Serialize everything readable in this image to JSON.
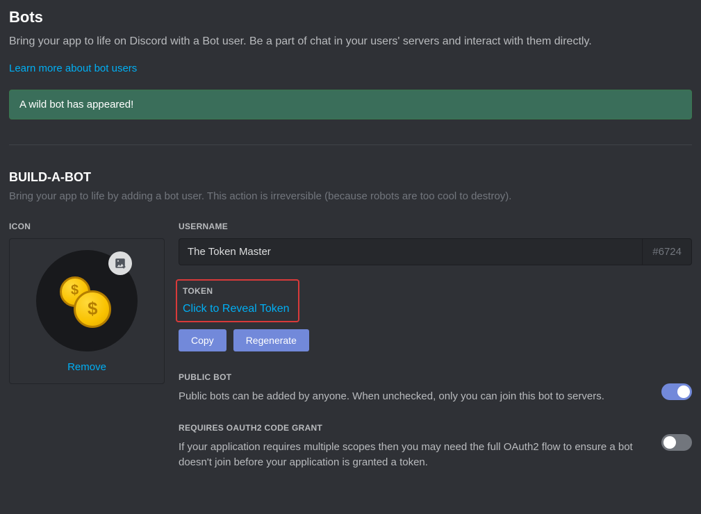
{
  "header": {
    "title": "Bots",
    "description": "Bring your app to life on Discord with a Bot user. Be a part of chat in your users' servers and interact with them directly.",
    "learn_more": "Learn more about bot users"
  },
  "alert": {
    "message": "A wild bot has appeared!"
  },
  "build": {
    "title": "BUILD-A-BOT",
    "description": "Bring your app to life by adding a bot user. This action is irreversible (because robots are too cool to destroy).",
    "icon_label": "ICON",
    "remove_label": "Remove",
    "username_label": "USERNAME",
    "username_value": "The Token Master",
    "discriminator": "#6724",
    "token_label": "TOKEN",
    "reveal_label": "Click to Reveal Token",
    "copy_label": "Copy",
    "regenerate_label": "Regenerate"
  },
  "settings": {
    "public_bot": {
      "label": "PUBLIC BOT",
      "description": "Public bots can be added by anyone. When unchecked, only you can join this bot to servers.",
      "enabled": true
    },
    "oauth2": {
      "label": "REQUIRES OAUTH2 CODE GRANT",
      "description": "If your application requires multiple scopes then you may need the full OAuth2 flow to ensure a bot doesn't join before your application is granted a token.",
      "enabled": false
    }
  }
}
